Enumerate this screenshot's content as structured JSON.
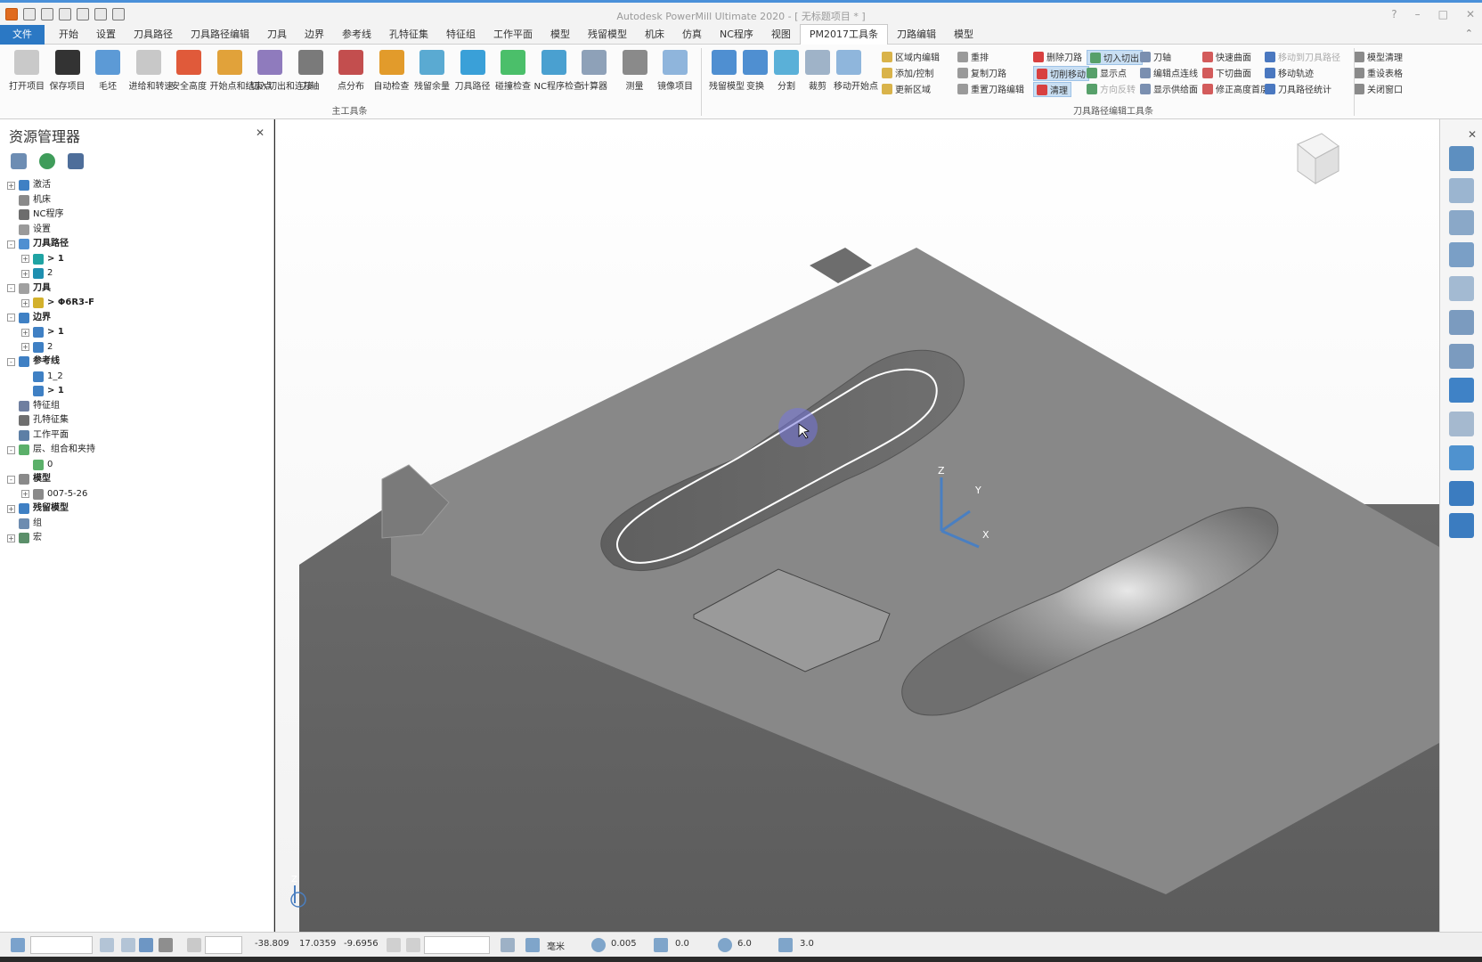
{
  "app": {
    "title": "Autodesk PowerMill Ultimate 2020 - [ 无标题项目 * ]"
  },
  "ribbon_tabs": [
    {
      "label": "文件"
    },
    {
      "label": "开始"
    },
    {
      "label": "设置"
    },
    {
      "label": "刀具路径"
    },
    {
      "label": "刀具路径编辑"
    },
    {
      "label": "刀具"
    },
    {
      "label": "边界"
    },
    {
      "label": "参考线"
    },
    {
      "label": "孔特征集"
    },
    {
      "label": "特征组"
    },
    {
      "label": "工作平面"
    },
    {
      "label": "模型"
    },
    {
      "label": "残留模型"
    },
    {
      "label": "机床"
    },
    {
      "label": "仿真"
    },
    {
      "label": "NC程序"
    },
    {
      "label": "视图"
    },
    {
      "label": "PM2017工具条"
    },
    {
      "label": "刀路编辑"
    },
    {
      "label": "模型"
    }
  ],
  "ribbon": {
    "main_group_label": "主工具条",
    "edit_group_label": "刀具路径编辑工具条",
    "main_buttons": [
      {
        "label": "打开项目"
      },
      {
        "label": "保存项目"
      },
      {
        "label": "毛坯"
      },
      {
        "label": "进给和转速"
      },
      {
        "label": "安全高度"
      },
      {
        "label": "开始点和结束点"
      },
      {
        "label": "切入切出和连接"
      },
      {
        "label": "刀轴"
      },
      {
        "label": "点分布"
      },
      {
        "label": "自动检查"
      },
      {
        "label": "残留余量"
      },
      {
        "label": "刀具路径"
      },
      {
        "label": "碰撞检查"
      },
      {
        "label": "NC程序检查"
      },
      {
        "label": "计算器"
      },
      {
        "label": "测量"
      },
      {
        "label": "镜像项目"
      }
    ],
    "edit_buttons": [
      {
        "label": "残留模型"
      },
      {
        "label": "变换"
      },
      {
        "label": "分割"
      },
      {
        "label": "裁剪"
      },
      {
        "label": "移动开始点"
      }
    ],
    "small_col1": [
      {
        "label": "区域内编辑"
      },
      {
        "label": "添加/控制"
      },
      {
        "label": "更新区域"
      }
    ],
    "small_col2": [
      {
        "label": "重排"
      },
      {
        "label": "复制刀路"
      },
      {
        "label": "重置刀路编辑"
      }
    ],
    "small_col3": [
      {
        "label": "删除刀路"
      },
      {
        "label": "切削移动"
      },
      {
        "label": "清理"
      }
    ],
    "small_col4": [
      {
        "label": "切入切出"
      },
      {
        "label": "显示点"
      },
      {
        "label": "方向反转"
      }
    ],
    "small_col5": [
      {
        "label": "刀轴"
      },
      {
        "label": "编辑点连线"
      },
      {
        "label": "显示供给面"
      }
    ],
    "small_col6": [
      {
        "label": "快速曲面"
      },
      {
        "label": "下切曲面"
      },
      {
        "label": "修正高度首层"
      }
    ],
    "small_col7": [
      {
        "label": "移动到刀具路径"
      },
      {
        "label": "移动轨迹"
      },
      {
        "label": "刀具路径统计"
      }
    ],
    "small_col8": [
      {
        "label": "模型清理"
      },
      {
        "label": "重设表格"
      },
      {
        "label": "关闭窗口"
      }
    ]
  },
  "explorer": {
    "title": "资源管理器",
    "tree": [
      {
        "label": "激活",
        "level": 0,
        "expander": "+",
        "bold": false
      },
      {
        "label": "机床",
        "level": 0,
        "expander": "",
        "bold": false
      },
      {
        "label": "NC程序",
        "level": 0,
        "expander": "",
        "bold": false
      },
      {
        "label": "设置",
        "level": 0,
        "expander": "",
        "bold": false
      },
      {
        "label": "刀具路径",
        "level": 0,
        "expander": "-",
        "bold": true
      },
      {
        "label": "> 1",
        "level": 1,
        "expander": "+",
        "bold": true
      },
      {
        "label": "2",
        "level": 1,
        "expander": "+",
        "bold": false
      },
      {
        "label": "刀具",
        "level": 0,
        "expander": "-",
        "bold": true
      },
      {
        "label": "> Φ6R3-F",
        "level": 1,
        "expander": "+",
        "bold": true
      },
      {
        "label": "边界",
        "level": 0,
        "expander": "-",
        "bold": true
      },
      {
        "label": "> 1",
        "level": 1,
        "expander": "+",
        "bold": true
      },
      {
        "label": "2",
        "level": 1,
        "expander": "+",
        "bold": false
      },
      {
        "label": "参考线",
        "level": 0,
        "expander": "-",
        "bold": true
      },
      {
        "label": "1_2",
        "level": 1,
        "expander": "",
        "bold": false
      },
      {
        "label": "> 1",
        "level": 1,
        "expander": "",
        "bold": true
      },
      {
        "label": "特征组",
        "level": 0,
        "expander": "",
        "bold": false
      },
      {
        "label": "孔特征集",
        "level": 0,
        "expander": "",
        "bold": false
      },
      {
        "label": "工作平面",
        "level": 0,
        "expander": "",
        "bold": false
      },
      {
        "label": "层、组合和夹持",
        "level": 0,
        "expander": "-",
        "bold": false
      },
      {
        "label": "0",
        "level": 1,
        "expander": "",
        "bold": false
      },
      {
        "label": "模型",
        "level": 0,
        "expander": "-",
        "bold": true
      },
      {
        "label": "007-5-26",
        "level": 1,
        "expander": "+",
        "bold": false
      },
      {
        "label": "残留模型",
        "level": 0,
        "expander": "+",
        "bold": true
      },
      {
        "label": "组",
        "level": 0,
        "expander": "",
        "bold": false
      },
      {
        "label": "宏",
        "level": 0,
        "expander": "+",
        "bold": false
      }
    ]
  },
  "viewport": {
    "triad": {
      "x_label": "X",
      "y_label": "Y",
      "z_label": "Z"
    },
    "corner_z_label": "Z",
    "colors": {
      "face": "#8a8a8a",
      "dark": "#666666",
      "toolpath": "#ffffff",
      "cursor": "#7777dd"
    }
  },
  "statusbar": {
    "x": "-38.809",
    "y": "17.0359",
    "z": "-9.6956",
    "units": "毫米",
    "tolerance": "0.005",
    "thickness": "0.0",
    "diameter": "6.0",
    "step": "3.0"
  }
}
